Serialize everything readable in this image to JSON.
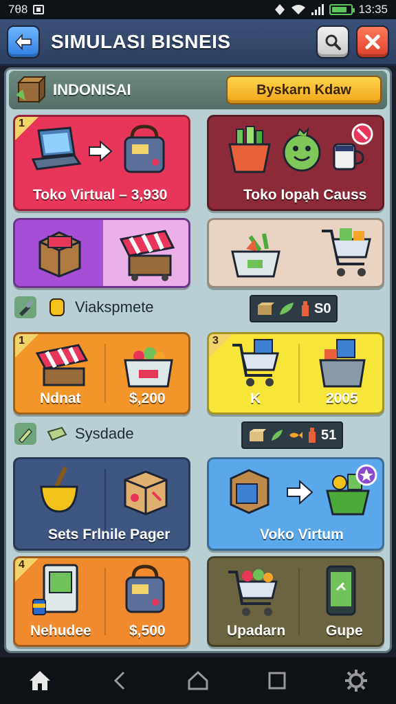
{
  "status_bar": {
    "left_text": "7θ8",
    "time": "13:35",
    "battery_level": 0.8
  },
  "header": {
    "title": "SIMULASI BISNEIS"
  },
  "region": {
    "name": "INDONISAI",
    "button_label": "Byskarn Kdaw"
  },
  "cards": [
    {
      "label": "Toko Virtual – 3,930",
      "badge": "1",
      "color": "#e8365a"
    },
    {
      "label": "Toko Iopạh Causs",
      "color": "#8c2a3a"
    },
    {
      "label": "",
      "color": "#a64fd6"
    },
    {
      "label": "",
      "color": "#e9d4c4"
    },
    {
      "label_left": "Ndnat",
      "label_right": "$,200",
      "badge": "1",
      "color": "#f3962a"
    },
    {
      "label_left": "K",
      "label_right": "2005",
      "badge": "3",
      "color": "#f8e53a"
    },
    {
      "label": "Sets Frlnile Pager",
      "color": "#3f5683"
    },
    {
      "label": "Voko Virtum",
      "color": "#5aa7ea"
    },
    {
      "label_left": "Nehudee",
      "label_right": "$,500",
      "badge": "4",
      "color": "#f08a2e"
    },
    {
      "label_left": "Upadarn",
      "label_right": "Gupe",
      "color": "#6a6540"
    }
  ],
  "sections": [
    {
      "label": "Viakspmete",
      "stat_value": "S0"
    },
    {
      "label": "Sysdade",
      "stat_value": "51"
    }
  ],
  "icons": {
    "back": "back-arrow-icon",
    "search": "search-icon",
    "close": "close-icon",
    "region": "crate-icon",
    "nav": [
      "home-icon",
      "back-icon",
      "house-outline-icon",
      "square-icon",
      "gear-icon"
    ]
  }
}
